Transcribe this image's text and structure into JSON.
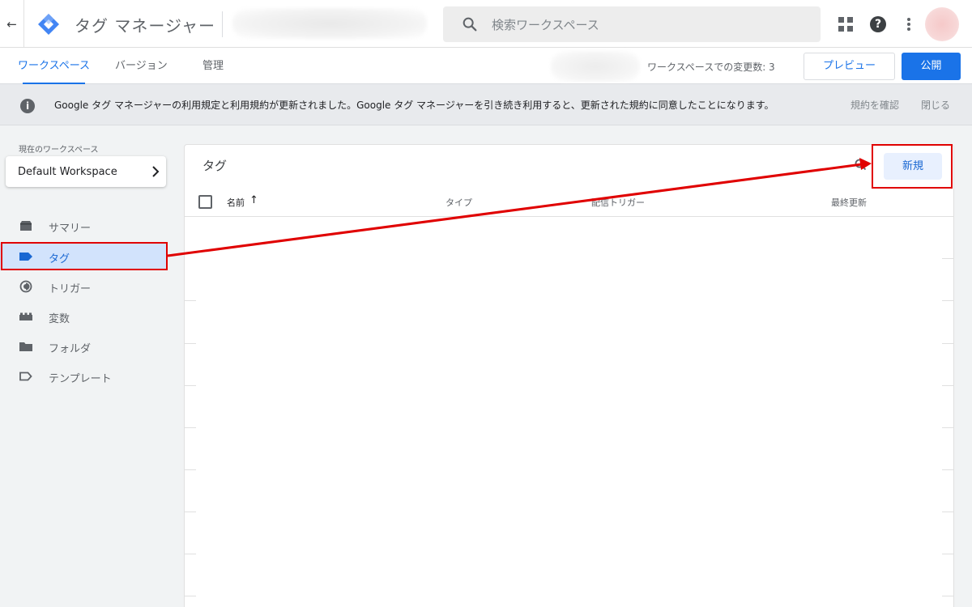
{
  "header": {
    "back_icon": "arrow-left-icon",
    "logo_icon": "gtm-diamond-logo",
    "app_title": "タグ マネージャー",
    "search_placeholder": "検索ワークスペース",
    "apps_icon": "apps-grid-icon",
    "help_icon": "help-icon",
    "more_icon": "more-vert-icon"
  },
  "tabs": [
    {
      "label": "ワークスペース",
      "active": true
    },
    {
      "label": "バージョン",
      "active": false
    },
    {
      "label": "管理",
      "active": false
    }
  ],
  "toolbar": {
    "changes_text": "ワークスペースでの変更数: 3",
    "preview_label": "プレビュー",
    "publish_label": "公開"
  },
  "notice": {
    "icon": "info-icon",
    "message": "Google タグ マネージャーの利用規定と利用規約が更新されました。Google タグ マネージャーを引き続き利用すると、更新された規約に同意したことになります。",
    "terms_link": "規約を確認",
    "close_link": "閉じる"
  },
  "sidebar": {
    "workspace_label": "現在のワークスペース",
    "workspace_name": "Default Workspace",
    "items": [
      {
        "label": "サマリー",
        "icon": "summary-icon",
        "active": false
      },
      {
        "label": "タグ",
        "icon": "tag-icon",
        "active": true
      },
      {
        "label": "トリガー",
        "icon": "trigger-icon",
        "active": false
      },
      {
        "label": "変数",
        "icon": "variable-icon",
        "active": false
      },
      {
        "label": "フォルダ",
        "icon": "folder-icon",
        "active": false
      },
      {
        "label": "テンプレート",
        "icon": "template-icon",
        "active": false
      }
    ]
  },
  "main": {
    "title": "タグ",
    "new_label": "新規",
    "columns": {
      "name": "名前",
      "sort_arrow": "↑",
      "type": "タイプ",
      "trigger": "配信トリガー",
      "updated": "最終更新"
    }
  },
  "colors": {
    "accent": "#1a73e8",
    "highlight_annotation": "#e00000",
    "active_nav_bg": "#d2e3fc"
  }
}
